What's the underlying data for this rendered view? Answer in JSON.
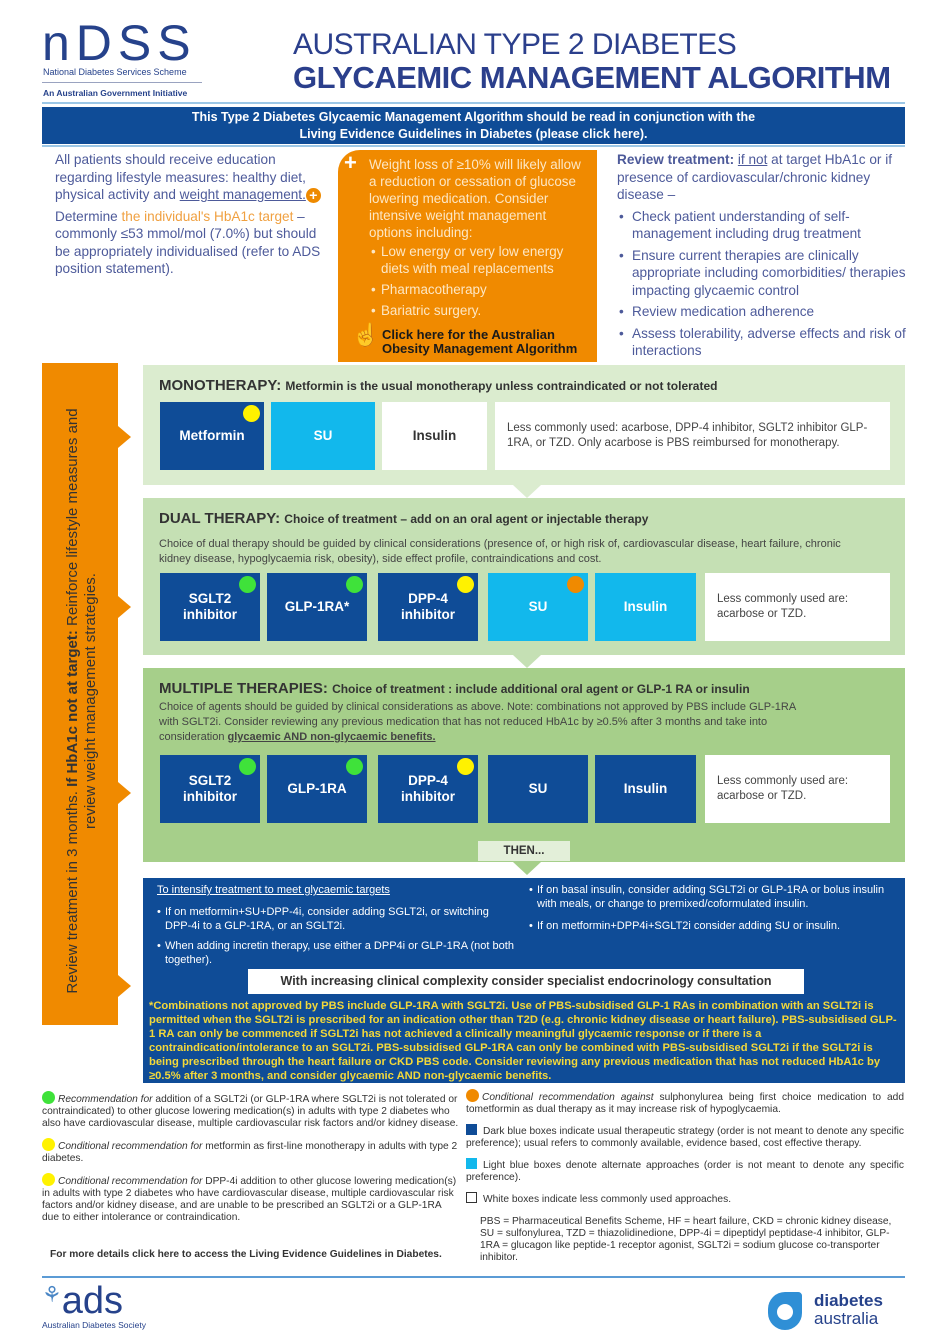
{
  "header": {
    "ndss_logo": "nDSS",
    "ndss_name": "National Diabetes Services Scheme",
    "ndss_gov": "An Australian Government Initiative",
    "title_line1": "AUSTRALIAN TYPE 2 DIABETES",
    "title_line2": "GLYCAEMIC MANAGEMENT ALGORITHM"
  },
  "banner": {
    "line1": "This Type 2 Diabetes Glycaemic Management Algorithm should be read in conjunction with the",
    "line2": "Living Evidence Guidelines in Diabetes (please click here)."
  },
  "intro": {
    "p1_text": "All patients should receive education regarding lifestyle measures: healthy diet, physical activity and ",
    "p1_link": "weight management.",
    "p2_a": "Determine ",
    "p2_highlight": "the individual's HbA1c  target",
    "p2_b": " – commonly ≤53 mmol/mol  (7.0%) but should be appropriately individualised (refer to ADS position statement)."
  },
  "weight_box": {
    "text": "Weight loss of ≥10% will likely allow a reduction or cessation of glucose lowering medication. Consider intensive weight management options including:",
    "items": [
      "Low energy or very low energy diets with meal replacements",
      "Pharmacotherapy",
      "Bariatric surgery."
    ],
    "link": "Click here for the Australian Obesity Management Algorithm"
  },
  "review": {
    "label": "Review treatment:",
    "if_not": "if not",
    "text": " at target HbA1c or if presence of cardiovascular/chronic kidney disease –",
    "items": [
      "Check patient understanding of self-management including drug treatment",
      "Ensure current therapies are clinically appropriate including comorbidities/ therapies impacting glycaemic control",
      "Review medication adherence",
      "Assess tolerability, adverse effects and risk of interactions"
    ]
  },
  "side_bar": {
    "a": "Review treatment in 3 months. ",
    "b": "If HbA1c not at target:",
    "c": " Reinforce lifestyle measures and review weight management strategies."
  },
  "monotherapy": {
    "title": "MONOTHERAPY:",
    "subtitle": "Metformin is the usual monotherapy unless contraindicated or not tolerated",
    "boxes": [
      "Metformin",
      "SU",
      "Insulin"
    ],
    "note": "Less commonly used: acarbose, DPP-4 inhibitor, SGLT2 inhibitor GLP-1RA, or TZD. Only acarbose is PBS reimbursed for monotherapy."
  },
  "dual": {
    "title": "DUAL THERAPY:",
    "subtitle": "Choice of treatment – add on an oral agent or injectable therapy",
    "desc": "Choice of dual therapy should be guided by clinical considerations (presence of, or high risk of, cardiovascular disease, heart failure, chronic kidney disease, hypoglycaemia risk, obesity), side effect profile, contraindications and cost.",
    "boxes": [
      "SGLT2 inhibitor",
      "GLP-1RA*",
      "DPP-4 inhibitor",
      "SU",
      "Insulin"
    ],
    "note": "Less commonly used are: acarbose or TZD."
  },
  "multiple": {
    "title": "MULTIPLE THERAPIES:",
    "subtitle": "Choice of treatment : include additional oral agent or GLP-1 RA or insulin",
    "desc": "Choice of agents should be guided by clinical considerations as above. Note: combinations not approved by PBS include GLP-1RA with SGLT2i. Consider reviewing any previous medication that has not reduced HbA1c by ≥0.5% after 3 months and take into consideration ",
    "desc_link": "glycaemic AND non-glycaemic benefits.",
    "boxes": [
      "SGLT2 inhibitor",
      "GLP-1RA",
      "DPP-4 inhibitor",
      "SU",
      "Insulin"
    ],
    "note": "Less commonly used are: acarbose or TZD.",
    "then": "THEN..."
  },
  "intensify": {
    "heading": "To intensify treatment to meet glycaemic targets",
    "left": [
      "If on metformin+SU+DPP-4i, consider adding SGLT2i, or switching DPP-4i to a GLP-1RA, or an SGLT2i.",
      "When adding incretin therapy, use either a DPP4i or GLP-1RA (not both together)."
    ],
    "right": [
      "If on basal insulin, consider adding SGLT2i or GLP-1RA or bolus insulin with meals, or change to premixed/coformulated insulin.",
      "If on metformin+DPP4i+SGLT2i consider adding SU or insulin."
    ],
    "specialist": "With increasing clinical complexity consider specialist endocrinology consultation",
    "footnote": "*Combinations not approved by PBS include GLP-1RA with SGLT2i. Use of PBS-subsidised GLP-1 RAs in combination with an SGLT2i is permitted when the SGLT2i is prescribed for an indication other than T2D (e.g. chronic kidney disease or heart failure). PBS-subsidised GLP-1 RA can only be commenced if SGLT2i has not achieved a clinically meaningful glycaemic response or if there is a contraindication/intolerance to an SGLT2i. PBS-subsidised GLP-1RA can only be combined with PBS-subsidised SGLT2i if the SGLT2i is being prescribed through the heart failure or CKD PBS code. Consider reviewing any previous medication that has not reduced HbA1c by ≥0.5% after 3 months, and consider glycaemic AND non-glycaemic benefits."
  },
  "legend": {
    "green": {
      "i": "Recommendation for",
      "t": " addition of a SGLT2i (or GLP-1RA where SGLT2i is not tolerated or contraindicated) to other glucose lowering medication(s) in adults with type 2 diabetes who also have cardiovascular disease, multiple cardiovascular risk factors and/or kidney disease."
    },
    "yellow1": {
      "i": "Conditional recommendation for",
      "t": " metformin as first-line monotherapy in adults with type 2 diabetes."
    },
    "yellow2": {
      "i": "Conditional recommendation for",
      "t": " DPP-4i addition to other glucose lowering medication(s) in adults with type 2 diabetes who have cardiovascular disease, multiple cardiovascular risk factors and/or kidney disease, and are unable to be prescribed an SGLT2i or a GLP-1RA due to either intolerance or contraindication."
    },
    "orange": {
      "i": "Conditional recommendation against",
      "t": " sulphonylurea being first choice medication to add tometformin as dual therapy as it may increase risk of hypoglycaemia."
    },
    "dark_blue": "Dark blue boxes indicate usual therapeutic strategy (order is not meant to denote any specific preference); usual refers to commonly available, evidence based, cost effective therapy.",
    "light_blue": "Light blue boxes denote alternate approaches (order is not meant to denote any specific preference).",
    "white": "White boxes indicate less commonly used approaches.",
    "abbrev": "PBS = Pharmaceutical Benefits Scheme, HF = heart failure, CKD = chronic kidney disease, SU = sulfonylurea, TZD = thiazolidinedione, DPP-4i = dipeptidyl peptidase-4 inhibitor, GLP-1RA = glucagon like peptide-1 receptor agonist, SGLT2i = sodium glucose co-transporter inhibitor.",
    "more": "For more details click here to access the Living Evidence Guidelines in Diabetes."
  },
  "footer": {
    "ads_logo": "ads",
    "ads_name": "Australian Diabetes Society",
    "da_line1": "diabetes",
    "da_line2": "australia"
  },
  "colors": {
    "dark_blue": "#0f4c97",
    "light_blue": "#12b8ec",
    "orange": "#f08a00",
    "green_dot": "#3fe23a",
    "yellow_dot": "#fff200"
  }
}
